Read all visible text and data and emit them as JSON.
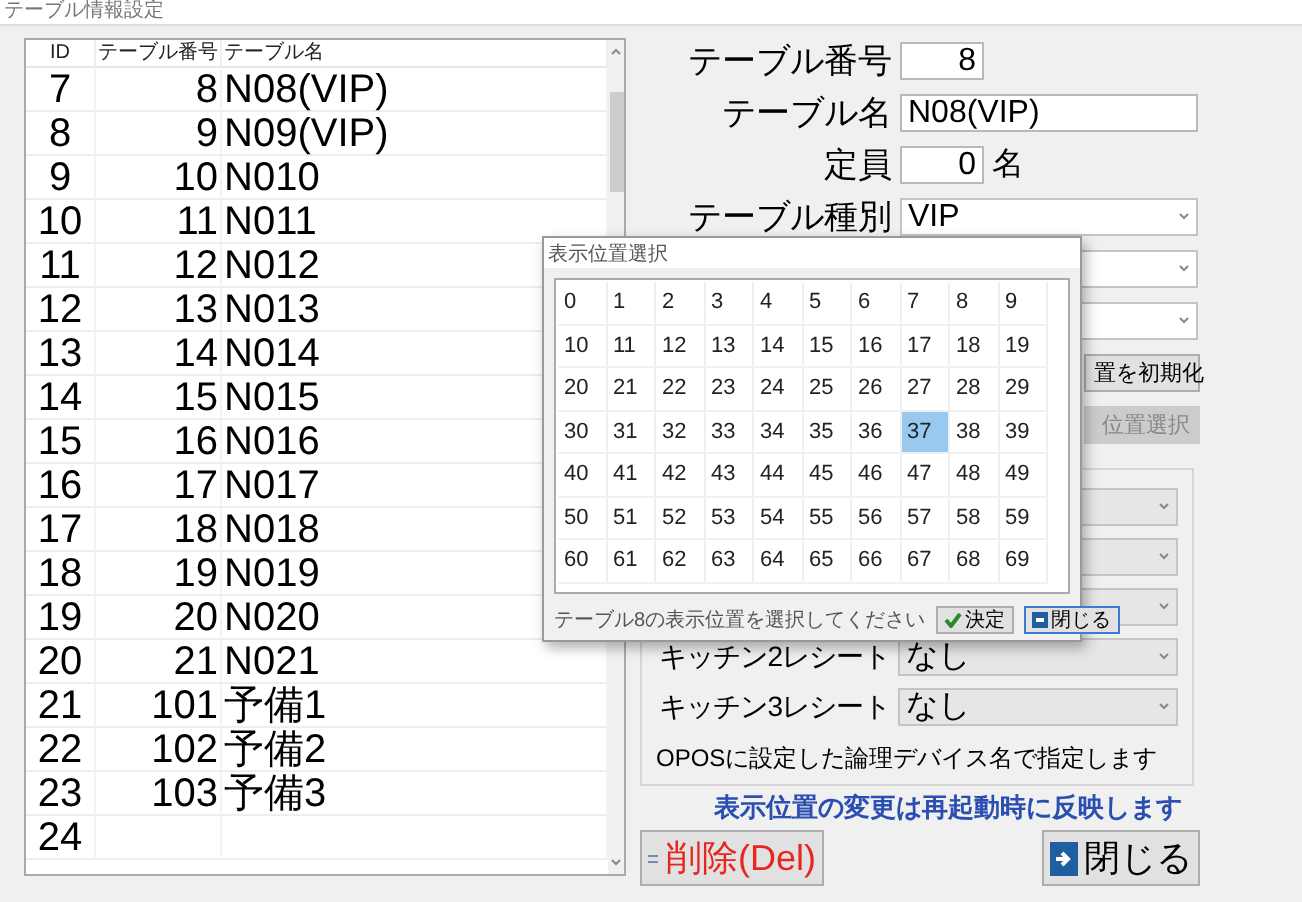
{
  "window": {
    "title": "テーブル情報設定"
  },
  "table": {
    "columns": [
      "ID",
      "テーブル番号",
      "テーブル名"
    ],
    "rows": [
      {
        "id": "7",
        "number": "8",
        "name": "N08(VIP)"
      },
      {
        "id": "8",
        "number": "9",
        "name": "N09(VIP)"
      },
      {
        "id": "9",
        "number": "10",
        "name": "N010"
      },
      {
        "id": "10",
        "number": "11",
        "name": "N011"
      },
      {
        "id": "11",
        "number": "12",
        "name": "N012"
      },
      {
        "id": "12",
        "number": "13",
        "name": "N013"
      },
      {
        "id": "13",
        "number": "14",
        "name": "N014"
      },
      {
        "id": "14",
        "number": "15",
        "name": "N015"
      },
      {
        "id": "15",
        "number": "16",
        "name": "N016"
      },
      {
        "id": "16",
        "number": "17",
        "name": "N017"
      },
      {
        "id": "17",
        "number": "18",
        "name": "N018"
      },
      {
        "id": "18",
        "number": "19",
        "name": "N019"
      },
      {
        "id": "19",
        "number": "20",
        "name": "N020"
      },
      {
        "id": "20",
        "number": "21",
        "name": "N021"
      },
      {
        "id": "21",
        "number": "101",
        "name": "予備1"
      },
      {
        "id": "22",
        "number": "102",
        "name": "予備2"
      },
      {
        "id": "23",
        "number": "103",
        "name": "予備3"
      },
      {
        "id": "24"
      }
    ]
  },
  "form": {
    "fields": [
      {
        "kind": "number",
        "label": "テーブル番号",
        "value": "8"
      },
      {
        "kind": "text",
        "label": "テーブル名",
        "value": "N08(VIP)"
      },
      {
        "kind": "number",
        "label": "定員",
        "value": "0",
        "unit": "名"
      },
      {
        "kind": "select",
        "label": "テーブル種別",
        "value": "VIP"
      },
      {
        "kind": "select"
      },
      {
        "kind": "select"
      }
    ],
    "buttons": [
      {
        "label": "置を初期化",
        "disabled": false
      },
      {
        "label": "位置選択",
        "disabled": true
      }
    ]
  },
  "printers": {
    "rows": [
      {},
      {},
      {},
      {
        "label": "キッチン2レシート",
        "value": "なし"
      },
      {
        "label": "キッチン3レシート",
        "value": "なし"
      }
    ],
    "note": "OPOSに設定した論理デバイス名で指定します"
  },
  "notice": "表示位置の変更は再起動時に反映します",
  "delete_button": "削除(Del)",
  "close_button": "閉じる",
  "dialog": {
    "title": "表示位置選択",
    "grid": [
      [
        {
          "label": "0",
          "selected": false
        },
        {
          "label": "1",
          "selected": false
        },
        {
          "label": "2",
          "selected": false
        },
        {
          "label": "3",
          "selected": false
        },
        {
          "label": "4",
          "selected": false
        },
        {
          "label": "5",
          "selected": false
        },
        {
          "label": "6",
          "selected": false
        },
        {
          "label": "7",
          "selected": false
        },
        {
          "label": "8",
          "selected": false
        },
        {
          "label": "9",
          "selected": false
        }
      ],
      [
        {
          "label": "10",
          "selected": false
        },
        {
          "label": "11",
          "selected": false
        },
        {
          "label": "12",
          "selected": false
        },
        {
          "label": "13",
          "selected": false
        },
        {
          "label": "14",
          "selected": false
        },
        {
          "label": "15",
          "selected": false
        },
        {
          "label": "16",
          "selected": false
        },
        {
          "label": "17",
          "selected": false
        },
        {
          "label": "18",
          "selected": false
        },
        {
          "label": "19",
          "selected": false
        }
      ],
      [
        {
          "label": "20",
          "selected": false
        },
        {
          "label": "21",
          "selected": false
        },
        {
          "label": "22",
          "selected": false
        },
        {
          "label": "23",
          "selected": false
        },
        {
          "label": "24",
          "selected": false
        },
        {
          "label": "25",
          "selected": false
        },
        {
          "label": "26",
          "selected": false
        },
        {
          "label": "27",
          "selected": false
        },
        {
          "label": "28",
          "selected": false
        },
        {
          "label": "29",
          "selected": false
        }
      ],
      [
        {
          "label": "30",
          "selected": false
        },
        {
          "label": "31",
          "selected": false
        },
        {
          "label": "32",
          "selected": false
        },
        {
          "label": "33",
          "selected": false
        },
        {
          "label": "34",
          "selected": false
        },
        {
          "label": "35",
          "selected": false
        },
        {
          "label": "36",
          "selected": false
        },
        {
          "label": "37",
          "selected": true
        },
        {
          "label": "38",
          "selected": false
        },
        {
          "label": "39",
          "selected": false
        }
      ],
      [
        {
          "label": "40",
          "selected": false
        },
        {
          "label": "41",
          "selected": false
        },
        {
          "label": "42",
          "selected": false
        },
        {
          "label": "43",
          "selected": false
        },
        {
          "label": "44",
          "selected": false
        },
        {
          "label": "45",
          "selected": false
        },
        {
          "label": "46",
          "selected": false
        },
        {
          "label": "47",
          "selected": false
        },
        {
          "label": "48",
          "selected": false
        },
        {
          "label": "49",
          "selected": false
        }
      ],
      [
        {
          "label": "50",
          "selected": false
        },
        {
          "label": "51",
          "selected": false
        },
        {
          "label": "52",
          "selected": false
        },
        {
          "label": "53",
          "selected": false
        },
        {
          "label": "54",
          "selected": false
        },
        {
          "label": "55",
          "selected": false
        },
        {
          "label": "56",
          "selected": false
        },
        {
          "label": "57",
          "selected": false
        },
        {
          "label": "58",
          "selected": false
        },
        {
          "label": "59",
          "selected": false
        }
      ],
      [
        {
          "label": "60",
          "selected": false
        },
        {
          "label": "61",
          "selected": false
        },
        {
          "label": "62",
          "selected": false
        },
        {
          "label": "63",
          "selected": false
        },
        {
          "label": "64",
          "selected": false
        },
        {
          "label": "65",
          "selected": false
        },
        {
          "label": "66",
          "selected": false
        },
        {
          "label": "67",
          "selected": false
        },
        {
          "label": "68",
          "selected": false
        },
        {
          "label": "69",
          "selected": false
        }
      ]
    ],
    "hint": "テーブル8の表示位置を選択してください",
    "ok_button": "決定",
    "close_button": "閉じる"
  }
}
